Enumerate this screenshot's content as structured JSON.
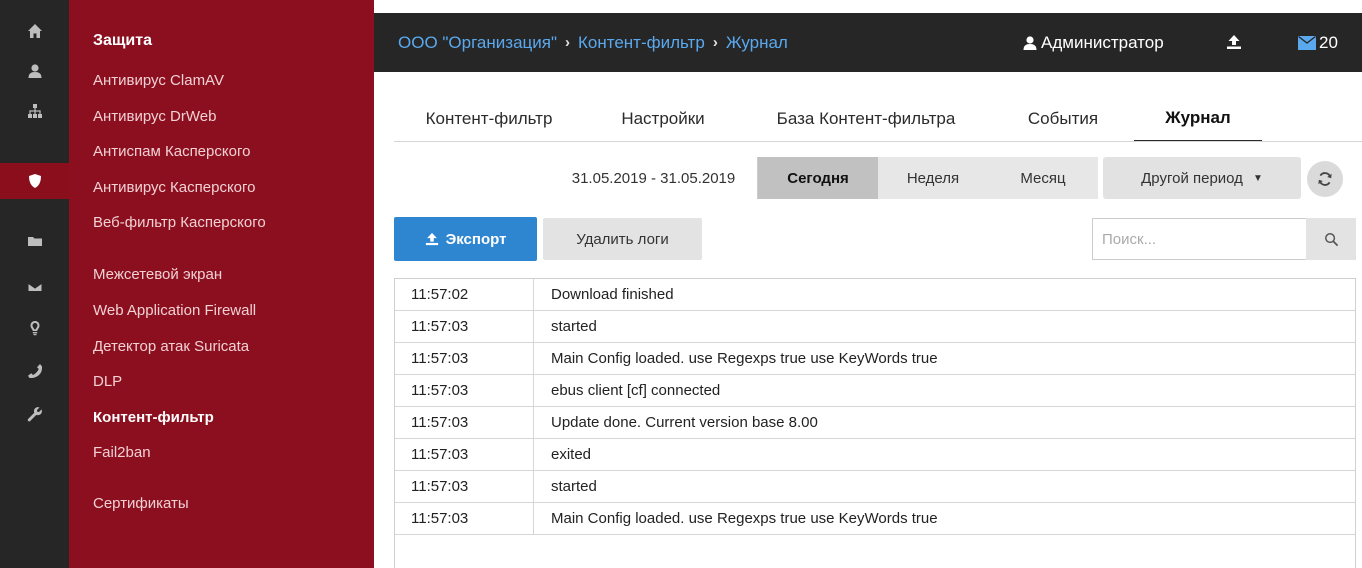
{
  "rail": [
    {
      "icon": "home-icon"
    },
    {
      "icon": "user-icon"
    },
    {
      "icon": "network-icon"
    },
    {
      "icon": "shield-icon",
      "active": true
    },
    {
      "icon": "folder-icon"
    },
    {
      "icon": "envelope-icon"
    },
    {
      "icon": "lightbulb-icon"
    },
    {
      "icon": "phone-icon"
    },
    {
      "icon": "wrench-icon"
    }
  ],
  "menu": {
    "title": "Защита",
    "items": [
      {
        "label": "Антивирус ClamAV"
      },
      {
        "label": "Антивирус DrWeb"
      },
      {
        "label": "Антиспам Касперского"
      },
      {
        "label": "Антивирус Касперского"
      },
      {
        "label": "Веб-фильтр Касперского"
      },
      {
        "label": "Межсетевой экран"
      },
      {
        "label": "Web Application Firewall"
      },
      {
        "label": "Детектор атак Suricata"
      },
      {
        "label": "DLP"
      },
      {
        "label": "Контент-фильтр",
        "current": true
      },
      {
        "label": "Fail2ban"
      },
      {
        "label": "Сертификаты"
      }
    ]
  },
  "header": {
    "breadcrumbs": [
      "ООО \"Организация\"",
      "Контент-фильтр",
      "Журнал"
    ],
    "breadcrumb_separator": "›",
    "user": "Администратор",
    "mail_count": "20"
  },
  "tabs": [
    {
      "label": "Контент-фильтр"
    },
    {
      "label": "Настройки"
    },
    {
      "label": "База Контент-фильтра"
    },
    {
      "label": "События"
    },
    {
      "label": "Журнал",
      "active": true
    }
  ],
  "period": {
    "range": "31.05.2019 - 31.05.2019",
    "today": "Сегодня",
    "week": "Неделя",
    "month": "Месяц",
    "other": "Другой период",
    "selected": "today"
  },
  "actions": {
    "export_label": "Экспорт",
    "delete_label": "Удалить логи",
    "search_placeholder": "Поиск..."
  },
  "log": [
    {
      "time": "11:57:02",
      "message": "Download finished"
    },
    {
      "time": "11:57:03",
      "message": "started"
    },
    {
      "time": "11:57:03",
      "message": "Main Config loaded. use Regexps true use KeyWords true"
    },
    {
      "time": "11:57:03",
      "message": "ebus client [cf] connected"
    },
    {
      "time": "11:57:03",
      "message": "Update done. Current version base 8.00"
    },
    {
      "time": "11:57:03",
      "message": "exited"
    },
    {
      "time": "11:57:03",
      "message": "started"
    },
    {
      "time": "11:57:03",
      "message": "Main Config loaded. use Regexps true use KeyWords true"
    }
  ],
  "colors": {
    "rail_bg": "#262626",
    "menu_bg": "#8c0f1f",
    "accent_blue": "#2e86d1",
    "link_blue": "#5aa9ef"
  }
}
